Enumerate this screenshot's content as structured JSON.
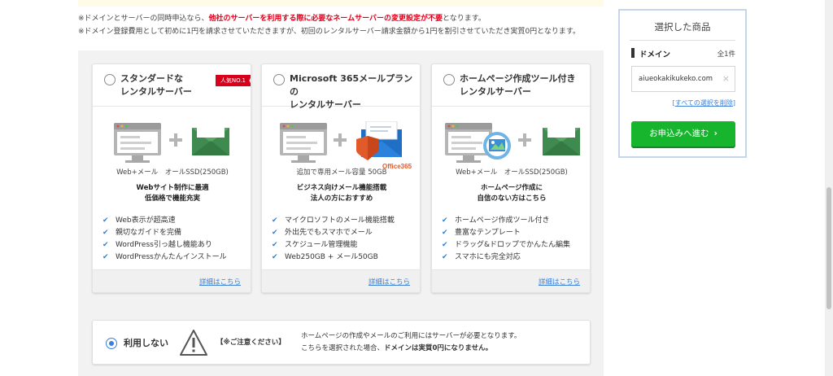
{
  "notes": {
    "line1_pre": "※ドメインとサーバーの同時申込なら、",
    "line1_red": "他社のサーバーを利用する際に必要なネームサーバーの変更設定が不要",
    "line1_post": "となります。",
    "line2": "※ドメイン登録費用として初めに1円を請求させていただきますが、初回のレンタルサーバー請求金額から1円を割引させていただき実質0円となります。"
  },
  "plans": [
    {
      "title_line1": "スタンダードな",
      "title_line2": "レンタルサーバー",
      "badge": "人気NO.1",
      "spec": "Web+メール　オールSSD(250GB)",
      "catch_line1": "Webサイト制作に最適",
      "catch_line2": "低価格で機能充実",
      "features": [
        "Web表示が超高速",
        "親切なガイドを完備",
        "WordPress引っ越し機能あり",
        "WordPressかんたんインストール"
      ],
      "detail": "詳細はこちら"
    },
    {
      "title_line1": "Microsoft 365メールプランの",
      "title_line2": "レンタルサーバー",
      "badge": "",
      "illus_label": "Office365",
      "spec": "追加で専用メール容量 50GB",
      "catch_line1": "ビジネス向けメール機能搭載",
      "catch_line2": "法人の方におすすめ",
      "features": [
        "マイクロソフトのメール機能搭載",
        "外出先でもスマホでメール",
        "スケジュール管理機能",
        "Web250GB + メール50GB"
      ],
      "detail": "詳細はこちら"
    },
    {
      "title_line1": "ホームページ作成ツール付き",
      "title_line2": "レンタルサーバー",
      "badge": "",
      "spec": "Web+メール　オールSSD(250GB)",
      "catch_line1": "ホームページ作成に",
      "catch_line2": "自信のない方はこちら",
      "features": [
        "ホームページ作成ツール付き",
        "豊富なテンプレート",
        "ドラッグ&ドロップでかんたん編集",
        "スマホにも完全対応"
      ],
      "detail": "詳細はこちら"
    }
  ],
  "nouse": {
    "label": "利用しない",
    "caution": "【※ご注意ください】",
    "line1": "ホームページの作成やメールのご利用にはサーバーが必要となります。",
    "line2_pre": "こちらを選択された場合、",
    "line2_bold": "ドメインは実質0円になりません。"
  },
  "cart": {
    "title": "選択した商品",
    "domain_label": "ドメイン",
    "count": "全1件",
    "domain_name": "aiueokakikukeko.com",
    "remove": "×",
    "clear_open": "[",
    "clear_all": "すべての選択を削除",
    "clear_close": "]",
    "apply": "お申込みへ進む",
    "apply_chevron": "›"
  },
  "colors": {
    "accent_blue": "#3b7fd8",
    "apply_green": "#17b52e",
    "badge_red": "#d9001b",
    "warning_red": "#e0001b"
  }
}
